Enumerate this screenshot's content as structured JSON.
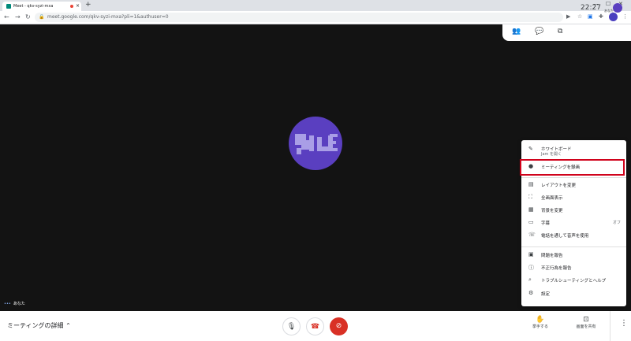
{
  "browser": {
    "tab_title": "Meet - qkv-syzi-mxa",
    "tab_close": "×",
    "new_tab": "+",
    "window_controls": [
      "—",
      "☐",
      "✕"
    ],
    "url": "meet.google.com/qkv-syzi-mxa?pli=1&authuser=0"
  },
  "meet": {
    "time": "22:27",
    "self_short": "あなた",
    "self_name": "あなた",
    "details_label": "ミーティングの詳細"
  },
  "menu": {
    "whiteboard": "ホワイトボード",
    "whiteboard_sub": "Jam を開く",
    "record": "ミーティングを録画",
    "layout": "レイアウトを変更",
    "fullscreen": "全画面表示",
    "background": "背景を変更",
    "captions": "字幕",
    "captions_state": "オフ",
    "phone_audio": "電話を通して音声を使用",
    "report_problem": "問題を報告",
    "report_abuse": "不正行為を報告",
    "troubleshoot": "トラブルシューティングとヘルプ",
    "settings": "設定"
  },
  "bottom": {
    "raise_hand": "挙手する",
    "present": "画面を共有"
  },
  "colors": {
    "accent_blue": "#1a73e8",
    "hangup_red": "#d93025",
    "highlight_red": "#d0021b",
    "avatar_purple": "#5a3fc0"
  },
  "icons": [
    "mic-icon",
    "hangup-icon",
    "camera-off-icon",
    "hand-icon",
    "present-icon",
    "more-vert-icon",
    "people-icon",
    "chat-icon",
    "activities-icon"
  ]
}
